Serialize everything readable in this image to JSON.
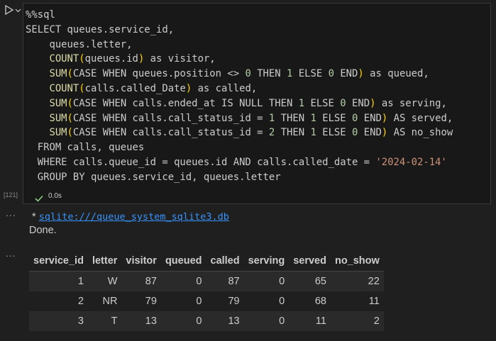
{
  "cell": {
    "code_lines": [
      "%%sql",
      "SELECT queues.service_id,",
      "    queues.letter,",
      "    COUNT(queues.id) as visitor,",
      "    SUM(CASE WHEN queues.position <> 0 THEN 1 ELSE 0 END) as queued,",
      "    COUNT(calls.called_Date) as called,",
      "    SUM(CASE WHEN calls.ended_at IS NULL THEN 1 ELSE 0 END) as serving,",
      "    SUM(CASE WHEN calls.call_status_id = 1 THEN 1 ELSE 0 END) AS served,",
      "    SUM(CASE WHEN calls.call_status_id = 2 THEN 1 ELSE 0 END) AS no_show",
      "  FROM calls, queues",
      "  WHERE calls.queue_id = queues.id AND calls.called_date = '2024-02-14'",
      "  GROUP BY queues.service_id, queues.letter"
    ],
    "execution_count": "[121]",
    "exec_time": "0.0s"
  },
  "output": {
    "connection_prefix": " * ",
    "connection_link": "sqlite:///queue_system_sqlite3.db",
    "done_text": "Done.",
    "dots": "..."
  },
  "table": {
    "columns": [
      "service_id",
      "letter",
      "visitor",
      "queued",
      "called",
      "serving",
      "served",
      "no_show"
    ],
    "rows": [
      [
        "1",
        "W",
        "87",
        "0",
        "87",
        "0",
        "65",
        "22"
      ],
      [
        "2",
        "NR",
        "79",
        "0",
        "79",
        "0",
        "68",
        "11"
      ],
      [
        "3",
        "T",
        "13",
        "0",
        "13",
        "0",
        "11",
        "2"
      ]
    ]
  },
  "colors": {
    "background": "#1f1f1f",
    "link": "#3794ff",
    "success_check": "#89d185",
    "function": "#dcdcaa",
    "paren": "#ffd700",
    "number": "#b5cea8",
    "string": "#ce9178"
  },
  "icons": [
    "run-icon",
    "chevron-down-icon",
    "check-icon"
  ]
}
